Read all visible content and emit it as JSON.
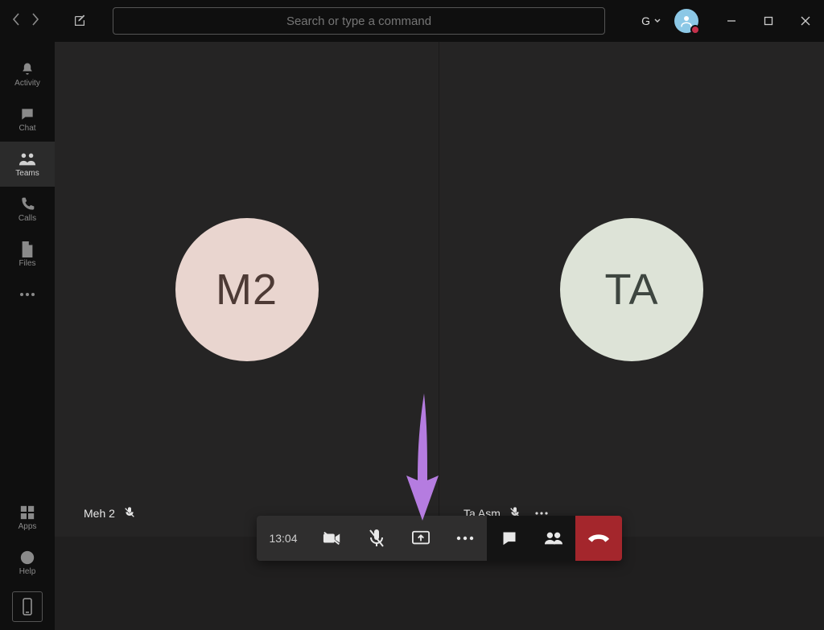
{
  "search": {
    "placeholder": "Search or type a command"
  },
  "org_label": "G",
  "rail": {
    "items": [
      {
        "label": "Activity"
      },
      {
        "label": "Chat"
      },
      {
        "label": "Teams"
      },
      {
        "label": "Calls"
      },
      {
        "label": "Files"
      }
    ],
    "ellipsis": ". . .",
    "apps": "Apps",
    "help": "Help"
  },
  "call": {
    "timer": "13:04",
    "participants": [
      {
        "initials": "M2",
        "name": "Meh 2"
      },
      {
        "initials": "TA",
        "name": "Ta Asm"
      }
    ]
  }
}
